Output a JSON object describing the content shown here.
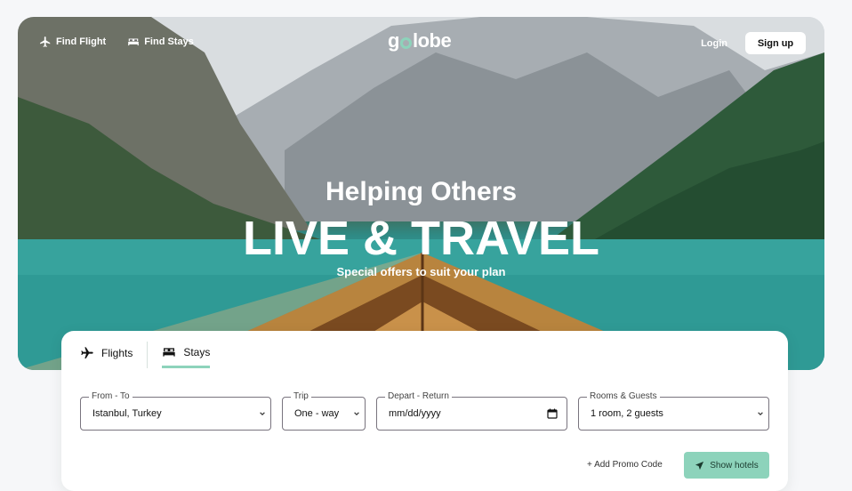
{
  "nav": {
    "find_flight": "Find Flight",
    "find_stays": "Find Stays",
    "logo": "golobe",
    "logo_parts": {
      "before": "g",
      "after": "lobe"
    },
    "login": "Login",
    "signup": "Sign up"
  },
  "hero": {
    "line1": "Helping Others",
    "line2": "LIVE & TRAVEL",
    "line3": "Special offers to suit your plan"
  },
  "search": {
    "tabs": [
      {
        "label": "Flights",
        "icon": "airplane-icon",
        "active": false
      },
      {
        "label": "Stays",
        "icon": "bed-icon",
        "active": true
      }
    ],
    "fields": {
      "from_to": {
        "legend": "From - To",
        "value": "Istanbul, Turkey"
      },
      "trip": {
        "legend": "Trip",
        "value": "One - way"
      },
      "depart_return": {
        "legend": "Depart - Return",
        "value": "mm/dd/yyyy"
      },
      "rooms_guests": {
        "legend": "Rooms & Guests",
        "value": "1 room, 2 guests"
      }
    },
    "promo": "+ Add Promo Code",
    "submit": "Show hotels"
  },
  "colors": {
    "accent": "#8dd3bb",
    "white": "#ffffff",
    "text": "#111111"
  }
}
